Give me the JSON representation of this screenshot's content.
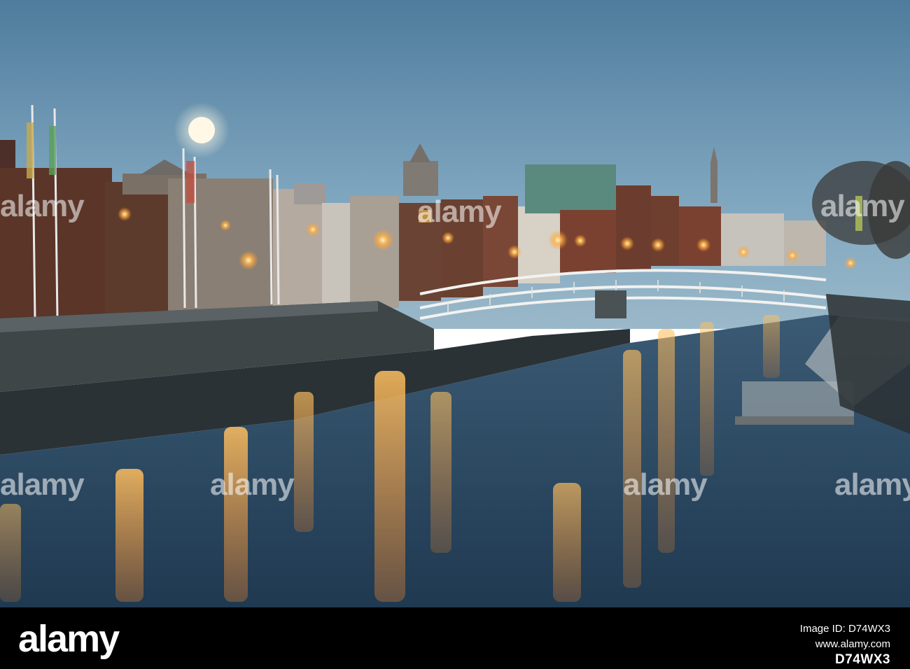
{
  "watermark": {
    "text": "alamy"
  },
  "footer": {
    "logo": "alamy",
    "image_id_label": "Image ID: D74WX3",
    "site": "www.alamy.com",
    "image_code": "D74WX3"
  },
  "colors": {
    "sky_top": "#5b86a6",
    "sky_bottom": "#8fb3c8",
    "water": "#2d4a63",
    "lamp_glow": "#ffb347",
    "footer_bg": "#000000"
  }
}
